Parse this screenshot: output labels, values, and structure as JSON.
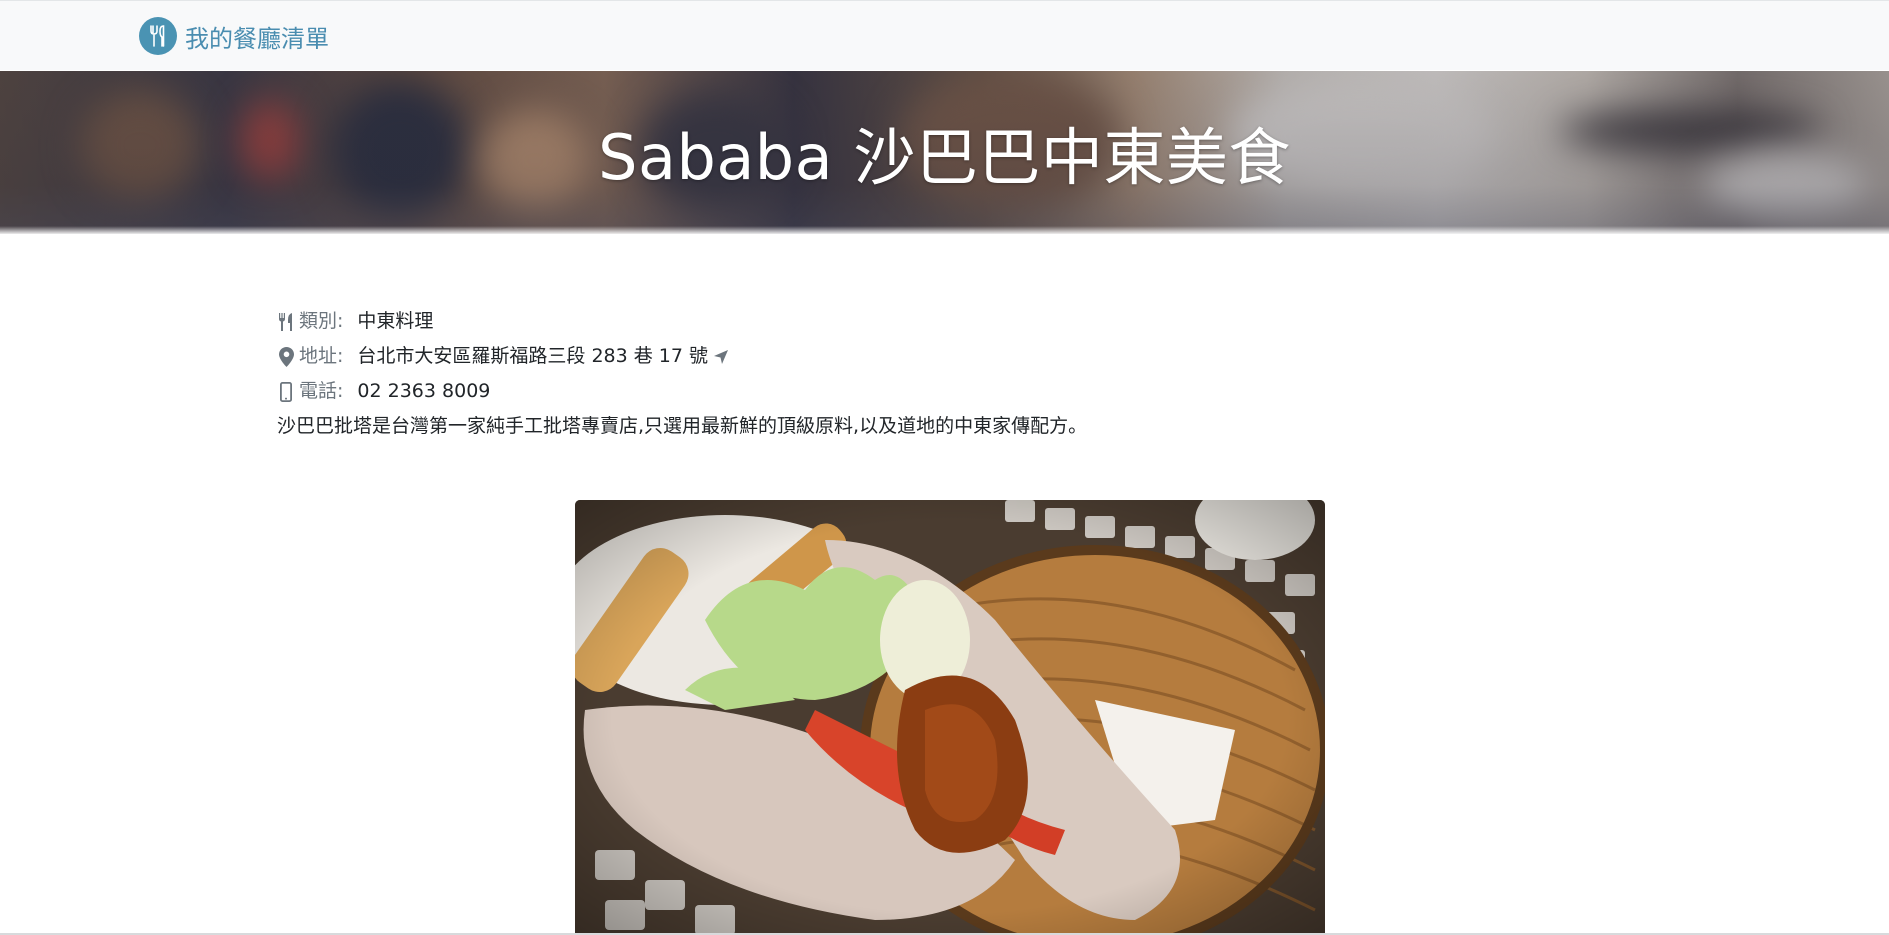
{
  "navbar": {
    "brand_label": "我的餐廳清單",
    "brand_icon": "utensils-icon",
    "brand_color": "#4a8db0"
  },
  "hero": {
    "title": "Sababa 沙巴巴中東美食"
  },
  "restaurant": {
    "category_label": "類別:",
    "category_icon": "utensils-icon",
    "category": "中東料理",
    "address_label": "地址:",
    "address_icon": "map-marker-icon",
    "address": "台北市大安區羅斯福路三段 283 巷 17 號",
    "address_link_icon": "location-arrow-icon",
    "phone_label": "電話:",
    "phone_icon": "mobile-phone-icon",
    "phone": "02 2363 8009",
    "description": "沙巴巴批塔是台灣第一家純手工批塔專賣店,只選用最新鮮的頂級原料,以及道地的中東家傳配方。"
  },
  "photo": {
    "subject": "pita sandwich with fried chicken, lettuce, tomato and sauce in a wicker basket"
  }
}
